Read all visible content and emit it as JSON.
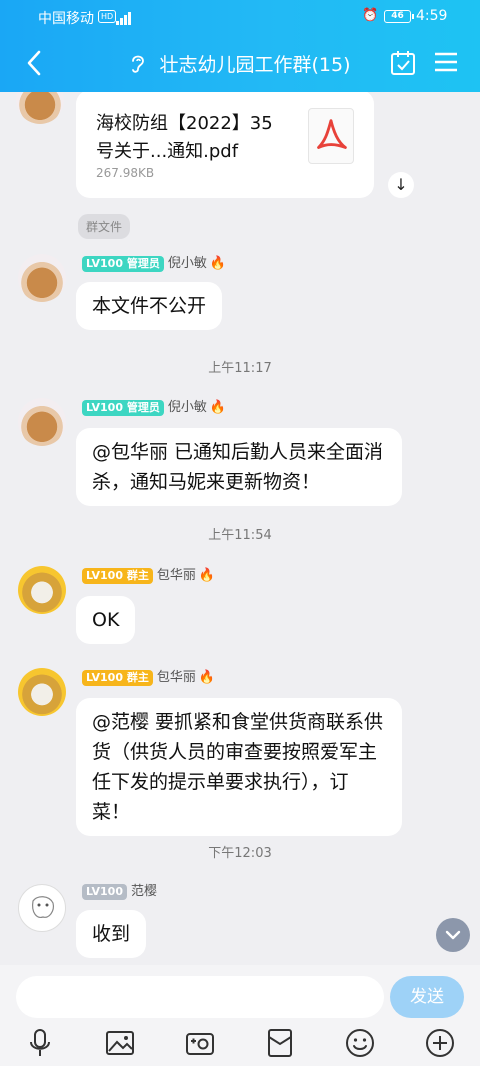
{
  "status_bar": {
    "carrier": "中国移动",
    "hd": "HD",
    "battery": "46",
    "time": "4:59"
  },
  "header": {
    "title": "壮志幼儿园工作群(15)"
  },
  "file_message": {
    "name": "海校防组【2022】35号关于...通知.pdf",
    "size": "267.98KB",
    "tag": "群文件"
  },
  "messages": [
    {
      "level": "LV100",
      "role": "管理员",
      "sender": "倪小敏",
      "text": "本文件不公开"
    },
    {
      "timestamp": "上午11:17"
    },
    {
      "level": "LV100",
      "role": "管理员",
      "sender": "倪小敏",
      "text": "@包华丽 已通知后勤人员来全面消杀，通知马妮来更新物资！"
    },
    {
      "timestamp": "上午11:54"
    },
    {
      "level": "LV100",
      "role": "群主",
      "sender": "包华丽",
      "text": "OK"
    },
    {
      "level": "LV100",
      "role": "群主",
      "sender": "包华丽",
      "text": "@范樱 要抓紧和食堂供货商联系供货（供货人员的审查要按照爱军主任下发的提示单要求执行），订菜！"
    },
    {
      "timestamp": "下午12:03"
    },
    {
      "level": "LV100",
      "role": "",
      "sender": "范樱",
      "text": "收到"
    }
  ],
  "input": {
    "placeholder": "",
    "send_label": "发送"
  },
  "colors": {
    "header_start": "#1aa7f5",
    "header_end": "#1ec3f3",
    "admin_badge": "#3dd6c2",
    "owner_badge": "#f7b51b",
    "send_button": "#9ed2f7"
  },
  "icons": [
    "back-arrow-icon",
    "hearing-icon",
    "calendar-check-icon",
    "menu-icon",
    "pdf-icon",
    "download-icon",
    "chevron-down-icon",
    "microphone-icon",
    "image-icon",
    "camera-icon",
    "red-packet-icon",
    "emoji-icon",
    "plus-icon"
  ]
}
